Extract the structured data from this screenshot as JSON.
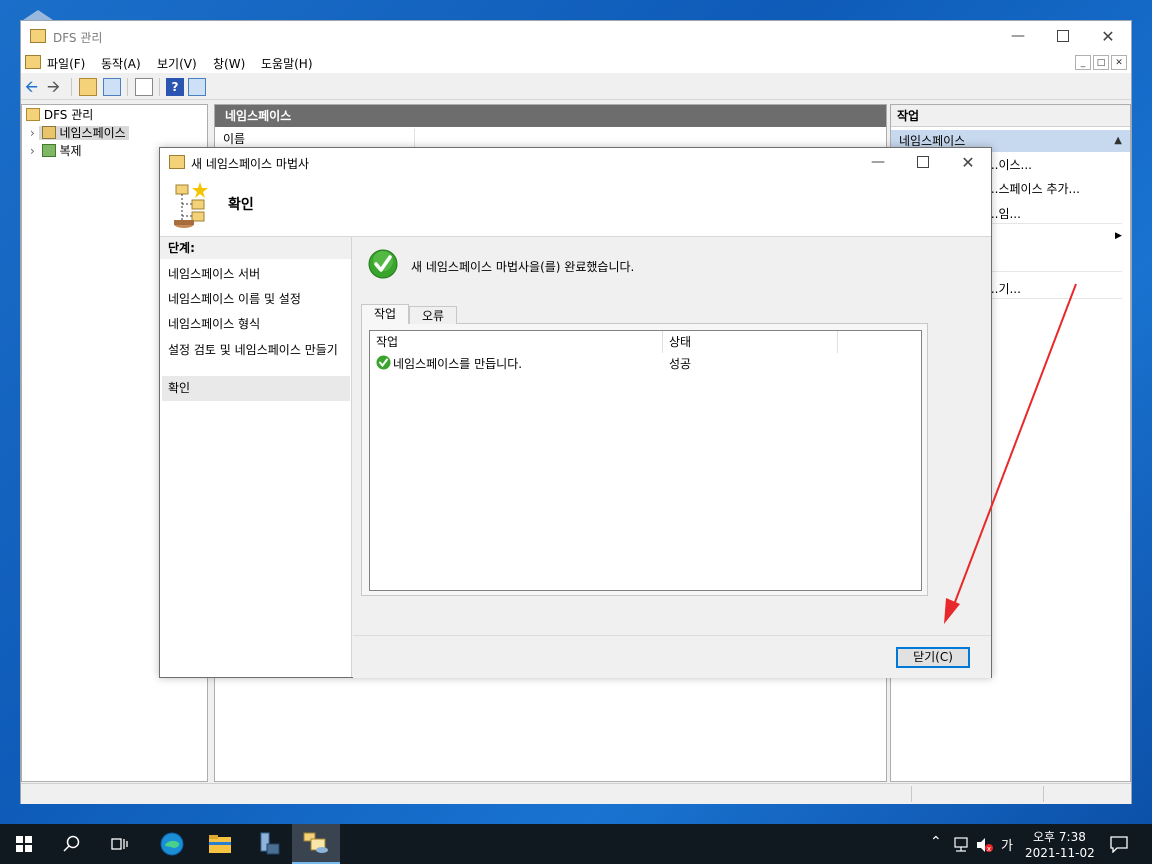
{
  "mmc": {
    "title": "DFS 관리",
    "menu": [
      "파일(F)",
      "동작(A)",
      "보기(V)",
      "창(W)",
      "도움말(H)"
    ],
    "tree": {
      "root": "DFS 관리",
      "items": [
        "네임스페이스",
        "복제"
      ]
    },
    "center": {
      "header": "네임스페이스",
      "column_name": "이름"
    },
    "actions": {
      "header": "작업",
      "subheader": "네임스페이스",
      "items": [
        "...이스...",
        "...스페이스 추가...",
        "...임...",
        "...기..."
      ]
    }
  },
  "wizard": {
    "title": "새 네임스페이스 마법사",
    "page_title": "확인",
    "steps_header": "단계:",
    "steps": [
      "네임스페이스 서버",
      "네임스페이스 이름 및 설정",
      "네임스페이스 형식",
      "설정 검토 및 네임스페이스 만들기",
      "확인"
    ],
    "message": "새 네임스페이스 마법사을(를) 완료했습니다.",
    "tabs": [
      "작업",
      "오류"
    ],
    "columns": [
      "작업",
      "상태"
    ],
    "rows": [
      {
        "task": "네임스페이스를 만듭니다.",
        "status": "성공"
      }
    ],
    "close_button": "닫기(C)"
  },
  "taskbar": {
    "ime": "가",
    "time": "오후 7:38",
    "date": "2021-11-02"
  },
  "colors": {
    "accent": "#0078d7",
    "annotation_arrow": "#e8282a",
    "header_bar": "#6d6d6d",
    "taskbar": "#101820"
  }
}
